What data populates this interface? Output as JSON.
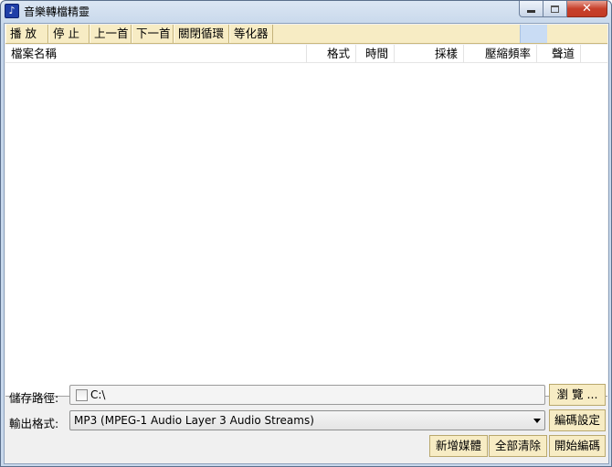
{
  "window": {
    "title": "音樂轉檔精靈"
  },
  "toolbar": {
    "items": [
      "播 放",
      "停 止",
      "上一首",
      "下一首",
      "關閉循環",
      "等化器"
    ]
  },
  "list": {
    "columns": [
      "檔案名稱",
      "格式",
      "時間",
      "採樣",
      "壓縮頻率",
      "聲道"
    ]
  },
  "save_path": {
    "label": "儲存路徑:",
    "value": "C:\\",
    "browse_label": "瀏 覽 ..."
  },
  "output_format": {
    "label": "輸出格式:",
    "selected": "MP3  (MPEG-1 Audio Layer 3 Audio Streams)",
    "settings_label": "編碼設定"
  },
  "actions": {
    "add_media": "新增媒體",
    "clear_all": "全部清除",
    "start_encode": "開始編碼"
  }
}
